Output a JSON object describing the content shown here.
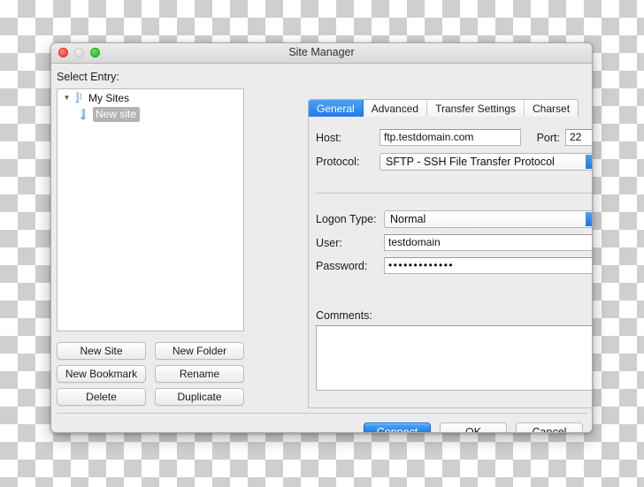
{
  "window": {
    "title": "Site Manager",
    "traffic_lights": [
      "close-button",
      "minimize-button",
      "zoom-button"
    ]
  },
  "left": {
    "select_entry_label": "Select Entry:",
    "tree": [
      {
        "label": "My Sites",
        "icon": "server-icon",
        "expanded": true,
        "selected": false,
        "depth": 0
      },
      {
        "label": "New site",
        "icon": "site-icon",
        "expanded": false,
        "selected": true,
        "depth": 1
      }
    ],
    "disclosure_glyph": "▼",
    "buttons": [
      "New Site",
      "New Folder",
      "New Bookmark",
      "Rename",
      "Delete",
      "Duplicate"
    ]
  },
  "right": {
    "tabs": [
      {
        "label": "General",
        "active": true
      },
      {
        "label": "Advanced",
        "active": false
      },
      {
        "label": "Transfer Settings",
        "active": false
      },
      {
        "label": "Charset",
        "active": false
      }
    ],
    "fields": {
      "host_label": "Host:",
      "host_value": "ftp.testdomain.com",
      "port_label": "Port:",
      "port_value": "22",
      "protocol_label": "Protocol:",
      "protocol_value": "SFTP - SSH File Transfer Protocol",
      "logon_type_label": "Logon Type:",
      "logon_type_value": "Normal",
      "user_label": "User:",
      "user_value": "testdomain",
      "password_label": "Password:",
      "password_value": "•••••••••••••",
      "comments_label": "Comments:",
      "comments_value": ""
    },
    "edge_artifact": "›"
  },
  "footer": {
    "buttons": [
      {
        "label": "Connect",
        "default": true
      },
      {
        "label": "OK",
        "default": false
      },
      {
        "label": "Cancel",
        "default": false
      }
    ]
  },
  "colors": {
    "accent_blue": "#1d7fec",
    "window_bg": "#ececec",
    "selection_gray": "#b4b4b4"
  }
}
